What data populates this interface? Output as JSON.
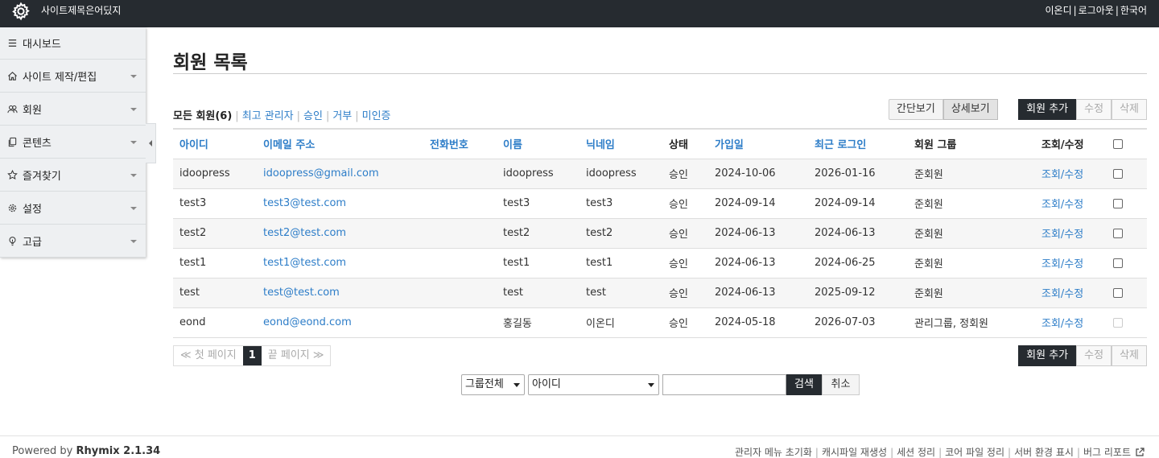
{
  "header": {
    "site_title": "사이트제목은어딨지",
    "user_links": [
      "이온디",
      "로그아웃",
      "한국어"
    ]
  },
  "sidebar": {
    "items": [
      {
        "label": "대시보드",
        "icon": "menu-icon",
        "has_caret": false
      },
      {
        "label": "사이트 제작/편집",
        "icon": "home-icon",
        "has_caret": true
      },
      {
        "label": "회원",
        "icon": "users-icon",
        "has_caret": true
      },
      {
        "label": "콘텐츠",
        "icon": "files-icon",
        "has_caret": true
      },
      {
        "label": "즐겨찾기",
        "icon": "star-icon",
        "has_caret": true
      },
      {
        "label": "설정",
        "icon": "gear-icon",
        "has_caret": true
      },
      {
        "label": "고급",
        "icon": "bulb-icon",
        "has_caret": true
      }
    ]
  },
  "main": {
    "title": "회원 목록",
    "filters": {
      "active": "모든 회원(6)",
      "links": [
        "최고 관리자",
        "승인",
        "거부",
        "미인증"
      ]
    },
    "view_buttons": {
      "simple": "간단보기",
      "detail": "상세보기"
    },
    "actions": {
      "add": "회원 추가",
      "edit": "수정",
      "delete": "삭제"
    },
    "table": {
      "headers": [
        "아이디",
        "이메일 주소",
        "전화번호",
        "이름",
        "닉네임",
        "상태",
        "가입일",
        "최근 로그인",
        "회원 그룹",
        "조회/수정"
      ],
      "rows": [
        {
          "id": "idoopress",
          "email": "idoopress@gmail.com",
          "phone": "",
          "name": "idoopress",
          "nick": "idoopress",
          "status": "승인",
          "joined": "2024-10-06",
          "last_login": "2026-01-16",
          "group": "준회원",
          "view": "조회/수정"
        },
        {
          "id": "test3",
          "email": "test3@test.com",
          "phone": "",
          "name": "test3",
          "nick": "test3",
          "status": "승인",
          "joined": "2024-09-14",
          "last_login": "2024-09-14",
          "group": "준회원",
          "view": "조회/수정"
        },
        {
          "id": "test2",
          "email": "test2@test.com",
          "phone": "",
          "name": "test2",
          "nick": "test2",
          "status": "승인",
          "joined": "2024-06-13",
          "last_login": "2024-06-13",
          "group": "준회원",
          "view": "조회/수정"
        },
        {
          "id": "test1",
          "email": "test1@test.com",
          "phone": "",
          "name": "test1",
          "nick": "test1",
          "status": "승인",
          "joined": "2024-06-13",
          "last_login": "2024-06-25",
          "group": "준회원",
          "view": "조회/수정"
        },
        {
          "id": "test",
          "email": "test@test.com",
          "phone": "",
          "name": "test",
          "nick": "test",
          "status": "승인",
          "joined": "2024-06-13",
          "last_login": "2025-09-12",
          "group": "준회원",
          "view": "조회/수정"
        },
        {
          "id": "eond",
          "email": "eond@eond.com",
          "phone": "",
          "name": "홍길동",
          "nick": "이온디",
          "status": "승인",
          "joined": "2024-05-18",
          "last_login": "2026-07-03",
          "group": "관리그룹, 정회원",
          "view": "조회/수정"
        }
      ]
    },
    "pager": {
      "first": "≪ 첫 페이지",
      "current": "1",
      "last": "끝 페이지 ≫"
    },
    "search": {
      "group_select": "그룹전체",
      "field_select": "아이디",
      "query": "",
      "search_label": "검색",
      "cancel_label": "취소"
    }
  },
  "footer": {
    "powered_prefix": "Powered by",
    "powered_product": "Rhymix 2.1.34",
    "links": [
      "관리자 메뉴 초기화",
      "캐시파일 재생성",
      "세션 정리",
      "코어 파일 정리",
      "서버 환경 표시",
      "버그 리포트"
    ]
  },
  "colors": {
    "header_bg": "#262b30",
    "link": "#2d7dc8",
    "sidebar_bg": "#eef0f2"
  }
}
